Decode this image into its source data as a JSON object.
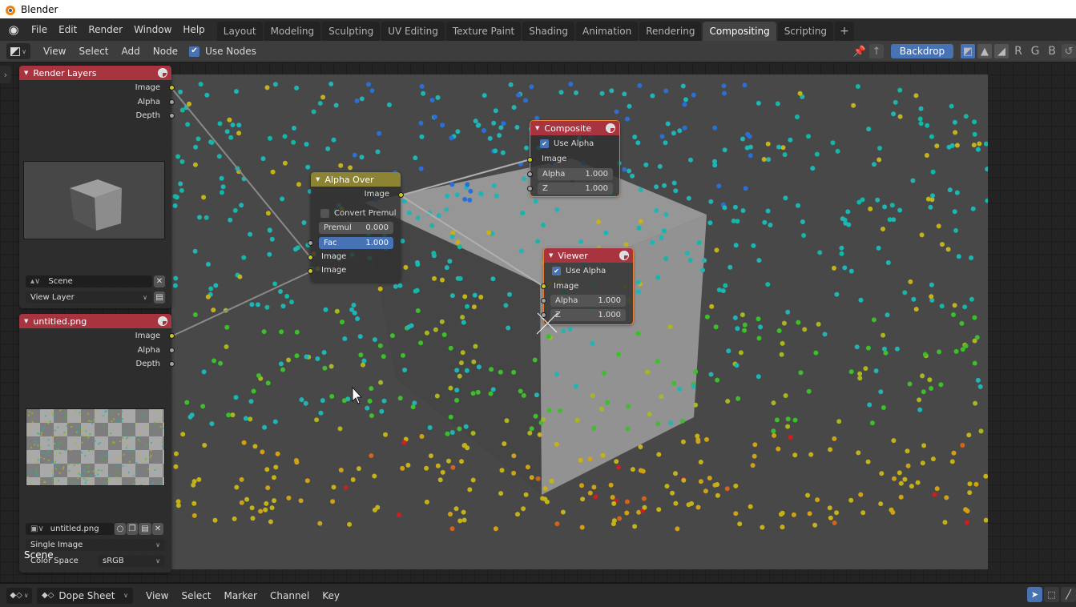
{
  "window": {
    "title": "Blender"
  },
  "topbar": {
    "menus": [
      "File",
      "Edit",
      "Render",
      "Window",
      "Help"
    ],
    "workspaces": [
      "Layout",
      "Modeling",
      "Sculpting",
      "UV Editing",
      "Texture Paint",
      "Shading",
      "Animation",
      "Rendering",
      "Compositing",
      "Scripting"
    ],
    "active_workspace": "Compositing",
    "add_tab": "+"
  },
  "node_header": {
    "menus": [
      "View",
      "Select",
      "Add",
      "Node"
    ],
    "use_nodes_label": "Use Nodes",
    "use_nodes_checked": true,
    "backdrop_label": "Backdrop",
    "channel_buttons": [
      "R",
      "G",
      "B"
    ]
  },
  "nodes": {
    "render_layers": {
      "title": "Render Layers",
      "outputs": [
        "Image",
        "Alpha",
        "Depth"
      ],
      "scene_value": "Scene",
      "view_layer_value": "View Layer"
    },
    "image": {
      "title": "untitled.png",
      "outputs": [
        "Image",
        "Alpha",
        "Depth"
      ],
      "image_name": "untitled.png",
      "source": "Single Image",
      "color_space_label": "Color Space",
      "color_space_value": "sRGB"
    },
    "alpha_over": {
      "title": "Alpha Over",
      "output": "Image",
      "convert_premul_label": "Convert Premul",
      "convert_premul_checked": false,
      "premul_label": "Premul",
      "premul_value": "0.000",
      "fac_label": "Fac",
      "fac_value": "1.000",
      "inputs": [
        "Image",
        "Image"
      ]
    },
    "composite": {
      "title": "Composite",
      "use_alpha_label": "Use Alpha",
      "use_alpha_checked": true,
      "image_label": "Image",
      "alpha_label": "Alpha",
      "alpha_value": "1.000",
      "z_label": "Z",
      "z_value": "1.000"
    },
    "viewer": {
      "title": "Viewer",
      "use_alpha_label": "Use Alpha",
      "use_alpha_checked": true,
      "image_label": "Image",
      "alpha_label": "Alpha",
      "alpha_value": "1.000",
      "z_label": "Z",
      "z_value": "1.000"
    }
  },
  "overlay_text": "Scene",
  "bottom_bar": {
    "editor_mode": "Dope Sheet",
    "menus": [
      "View",
      "Select",
      "Marker",
      "Channel",
      "Key"
    ]
  },
  "colors": {
    "accent_blue": "#4772b3",
    "node_header_output": "#a8343f",
    "node_header_mix": "#8c8334",
    "socket_image": "#c7c729",
    "socket_value": "#a1a1a1",
    "selection_outline": "#ed7d32",
    "point_palette": [
      "#1fb5b5",
      "#12b7a6",
      "#c4b219",
      "#aab51f",
      "#3cbf2a",
      "#d0a114",
      "#2a6fd6",
      "#d6621a",
      "#cc1f1f"
    ]
  }
}
